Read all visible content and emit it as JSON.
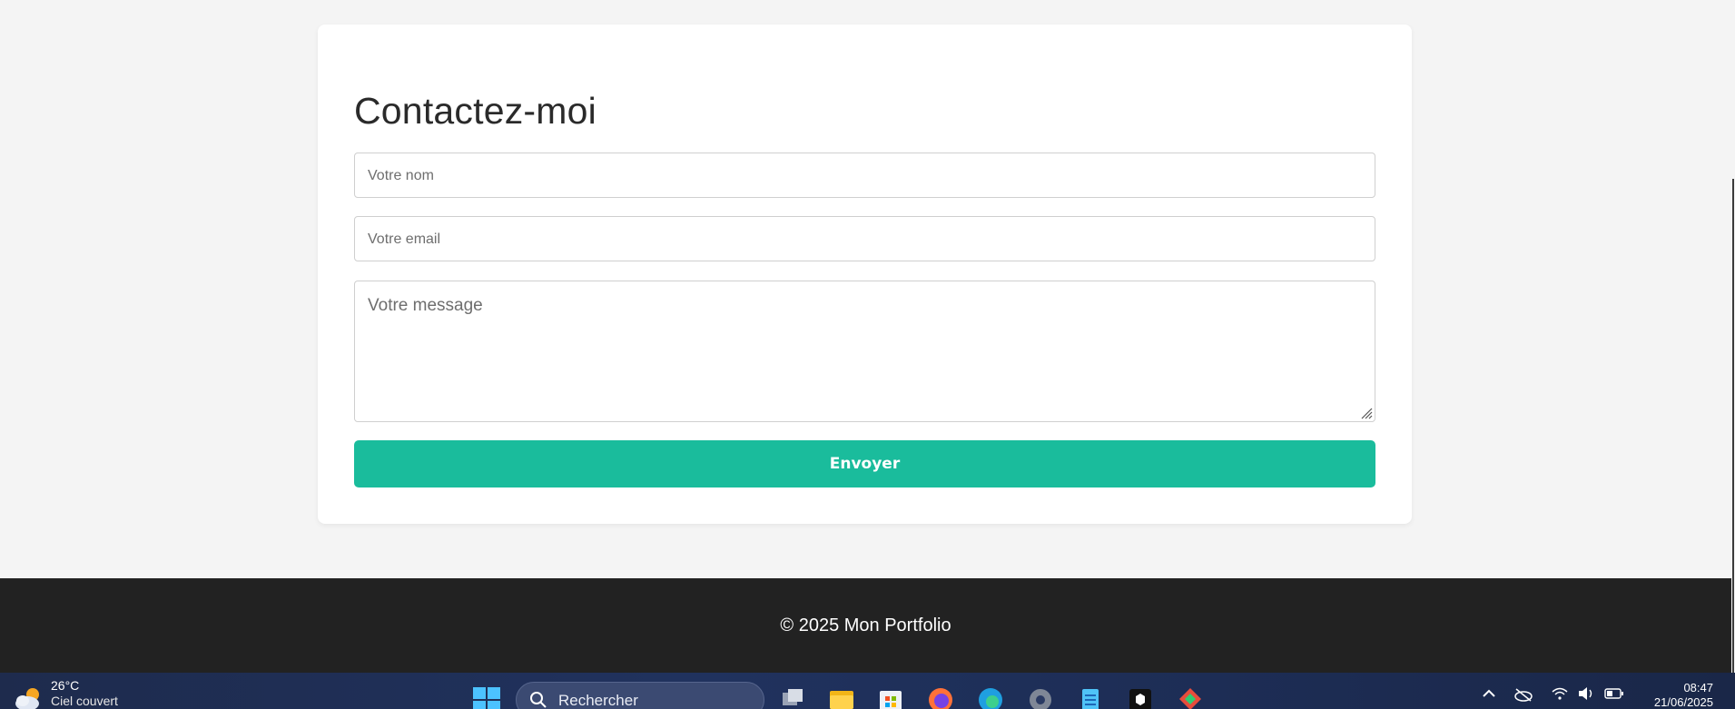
{
  "contact": {
    "title": "Contactez-moi",
    "name_placeholder": "Votre nom",
    "email_placeholder": "Votre email",
    "message_placeholder": "Votre message",
    "send_label": "Envoyer"
  },
  "footer": {
    "text": "© 2025 Mon Portfolio"
  },
  "taskbar": {
    "weather_temp": "26°C",
    "weather_desc": "Ciel couvert",
    "search_label": "Rechercher",
    "time": "08:47",
    "date": "21/06/2025",
    "icons": [
      "task-view-icon",
      "file-explorer-icon",
      "store-icon",
      "firefox-icon",
      "edge-icon",
      "settings-icon",
      "notepad-icon",
      "app-icon",
      "git-icon"
    ]
  },
  "colors": {
    "accent": "#1abc9c",
    "footer_bg": "#222222",
    "page_bg": "#f4f4f4"
  }
}
